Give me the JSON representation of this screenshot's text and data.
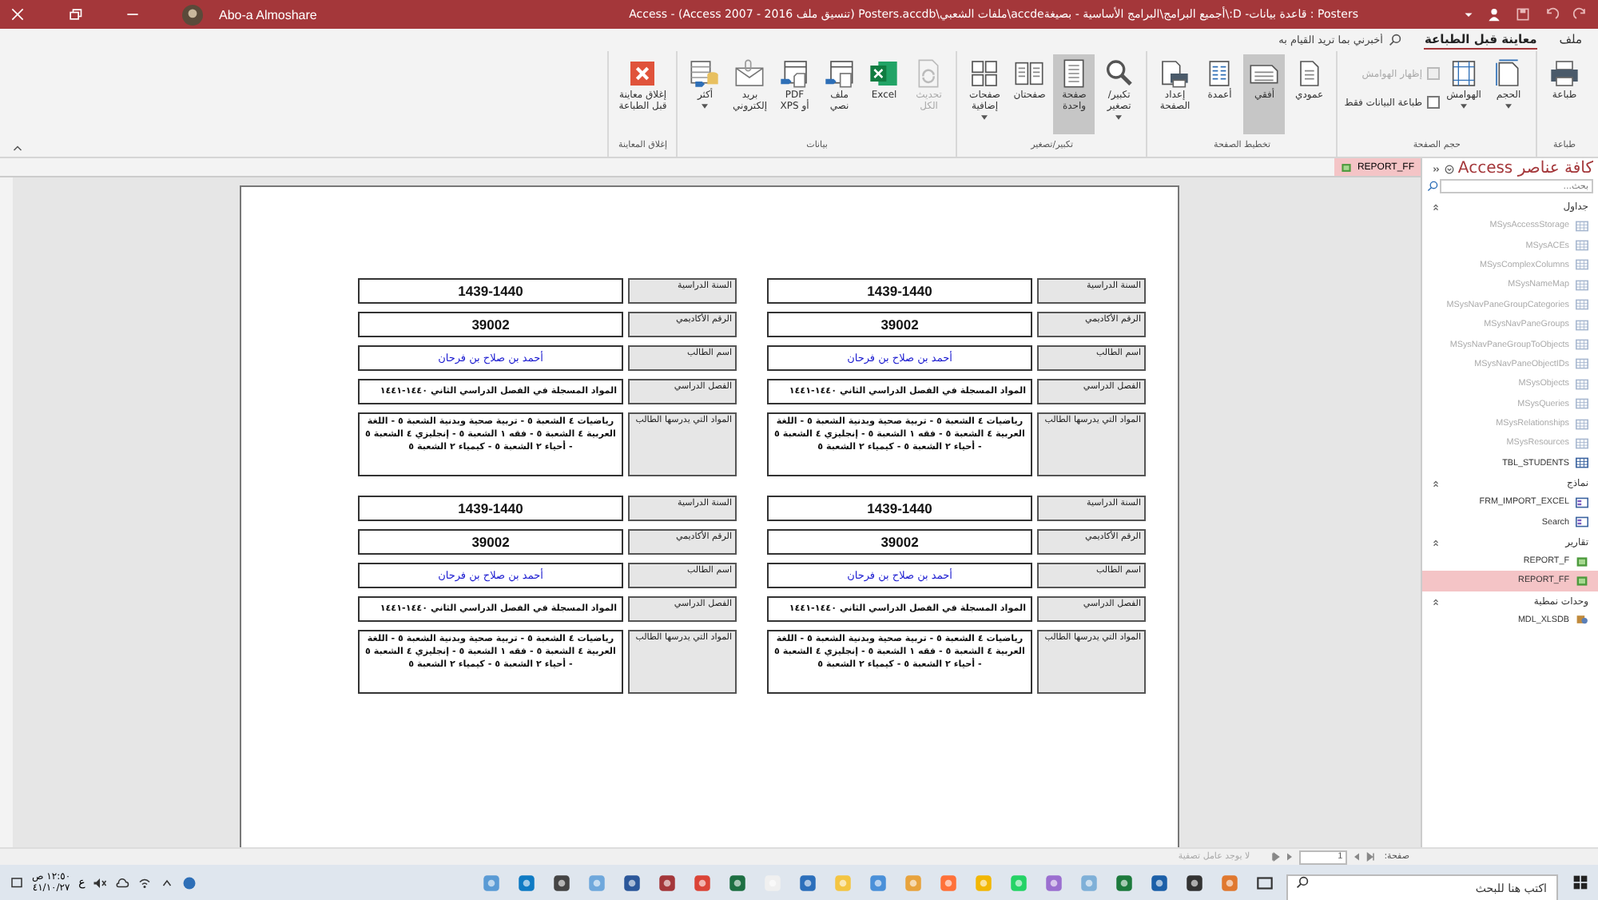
{
  "title_bar": {
    "title": "Posters : قاعدة بيانات- D:\\أجميع البرامج\\البرامج الأساسية - بصيغةaccde\\ملفات الشعبي\\Posters.accdb (تنسيق ملف 2016 - Access 2007) - Access",
    "user": "Abo-a Almoshare"
  },
  "ribbon": {
    "tabs": [
      {
        "label": "ملف",
        "selected": false
      },
      {
        "label": "معاينة قبل الطباعة",
        "selected": true
      }
    ],
    "tell_me": {
      "placeholder": "أخبرني بما تريد القيام به"
    },
    "groups": [
      {
        "label": "طباعة",
        "items": [
          {
            "kind": "large",
            "label": "طباعة",
            "selected": false,
            "disabled": false,
            "dropdown": false
          }
        ]
      },
      {
        "label": "حجم الصفحة",
        "items": [
          {
            "kind": "large",
            "label": "الحجم",
            "selected": false,
            "disabled": false,
            "dropdown": true
          },
          {
            "kind": "large",
            "label": "الهوامش",
            "selected": false,
            "disabled": false,
            "dropdown": true
          },
          {
            "kind": "checkbox",
            "label": "إظهار الهوامش",
            "checked": false,
            "disabled": true
          },
          {
            "kind": "checkbox",
            "label": "طباعة البيانات فقط",
            "checked": false,
            "disabled": false
          }
        ]
      },
      {
        "label": "تخطيط الصفحة",
        "items": [
          {
            "kind": "large",
            "label": "عمودي",
            "selected": false,
            "disabled": false,
            "dropdown": false
          },
          {
            "kind": "large",
            "label": "أفقي",
            "selected": true,
            "disabled": false,
            "dropdown": false
          },
          {
            "kind": "large",
            "label": "أعمدة",
            "selected": false,
            "disabled": false,
            "dropdown": false
          },
          {
            "kind": "large",
            "label": "إعداد\nالصفحة",
            "selected": false,
            "disabled": false,
            "dropdown": false
          }
        ]
      },
      {
        "label": "تكبير/تصغير",
        "items": [
          {
            "kind": "large",
            "label": "تكبير/\nتصغير",
            "selected": false,
            "disabled": false,
            "dropdown": true
          },
          {
            "kind": "large",
            "label": "صفحة\nواحدة",
            "selected": true,
            "disabled": false,
            "dropdown": false
          },
          {
            "kind": "large",
            "label": "صفحتان",
            "selected": false,
            "disabled": false,
            "dropdown": false
          },
          {
            "kind": "large",
            "label": "صفحات\nإضافية",
            "selected": false,
            "disabled": false,
            "dropdown": true
          }
        ]
      },
      {
        "label": "بيانات",
        "items": [
          {
            "kind": "large",
            "label": "تحديث\nالكل",
            "selected": false,
            "disabled": true,
            "dropdown": false
          },
          {
            "kind": "large",
            "label": "Excel",
            "selected": false,
            "disabled": false,
            "dropdown": false
          },
          {
            "kind": "large",
            "label": "ملف\nنصي",
            "selected": false,
            "disabled": false,
            "dropdown": false
          },
          {
            "kind": "large",
            "label": "PDF\nأو XPS",
            "selected": false,
            "disabled": false,
            "dropdown": false
          },
          {
            "kind": "large",
            "label": "بريد\nإلكتروني",
            "selected": false,
            "disabled": false,
            "dropdown": false
          },
          {
            "kind": "large",
            "label": "أكثر",
            "selected": false,
            "disabled": false,
            "dropdown": true
          }
        ]
      },
      {
        "label": "إغلاق المعاينة",
        "items": [
          {
            "kind": "large",
            "label": "إغلاق معاينة\nقبل الطباعة",
            "selected": false,
            "disabled": false,
            "dropdown": false
          }
        ]
      }
    ]
  },
  "document_tab": {
    "label": "REPORT_FF"
  },
  "report": {
    "cards": [
      {
        "fields": [
          {
            "kind": "heading",
            "label": "السنة الدراسية",
            "value": "1439-1440"
          },
          {
            "kind": "heading",
            "label": "الرقم الأكاديمي",
            "value": "39002"
          },
          {
            "kind": "name",
            "label": "اسم الطالب",
            "value": "أحمد بن صلاح بن فرحان"
          },
          {
            "kind": "line",
            "label": "الفصل الدراسي",
            "value": "المواد المسجلة في الفصل الدراسي الثاني ١٤٤٠-١٤٤١"
          },
          {
            "kind": "paragraph",
            "label": "المواد التي يدرسها الطالب",
            "value": "رياضيات ٤ الشعبة ٥ - تربية صحية وبدنية الشعبة ٥ - اللغة العربية ٤ الشعبة ٥ - فقه ١ الشعبة ٥ - إنجليزي ٤ الشعبة ٥ - أحياء ٢ الشعبة ٥ - كيمياء ٢ الشعبة ٥"
          }
        ]
      },
      {
        "fields": [
          {
            "kind": "heading",
            "label": "السنة الدراسية",
            "value": "1439-1440"
          },
          {
            "kind": "heading",
            "label": "الرقم الأكاديمي",
            "value": "39002"
          },
          {
            "kind": "name",
            "label": "اسم الطالب",
            "value": "أحمد بن صلاح بن فرحان"
          },
          {
            "kind": "line",
            "label": "الفصل الدراسي",
            "value": "المواد المسجلة في الفصل الدراسي الثاني ١٤٤٠-١٤٤١"
          },
          {
            "kind": "paragraph",
            "label": "المواد التي يدرسها الطالب",
            "value": "رياضيات ٤ الشعبة ٥ - تربية صحية وبدنية الشعبة ٥ - اللغة العربية ٤ الشعبة ٥ - فقه ١ الشعبة ٥ - إنجليزي ٤ الشعبة ٥ - أحياء ٢ الشعبة ٥ - كيمياء ٢ الشعبة ٥"
          }
        ]
      },
      {
        "fields": [
          {
            "kind": "heading",
            "label": "السنة الدراسية",
            "value": "1439-1440"
          },
          {
            "kind": "heading",
            "label": "الرقم الأكاديمي",
            "value": "39002"
          },
          {
            "kind": "name",
            "label": "اسم الطالب",
            "value": "أحمد بن صلاح بن فرحان"
          },
          {
            "kind": "line",
            "label": "الفصل الدراسي",
            "value": "المواد المسجلة في الفصل الدراسي الثاني ١٤٤٠-١٤٤١"
          },
          {
            "kind": "paragraph",
            "label": "المواد التي يدرسها الطالب",
            "value": "رياضيات ٤ الشعبة ٥ - تربية صحية وبدنية الشعبة ٥ - اللغة العربية ٤ الشعبة ٥ - فقه ١ الشعبة ٥ - إنجليزي ٤ الشعبة ٥ - أحياء ٢ الشعبة ٥ - كيمياء ٢ الشعبة ٥"
          }
        ]
      },
      {
        "fields": [
          {
            "kind": "heading",
            "label": "السنة الدراسية",
            "value": "1439-1440"
          },
          {
            "kind": "heading",
            "label": "الرقم الأكاديمي",
            "value": "39002"
          },
          {
            "kind": "name",
            "label": "اسم الطالب",
            "value": "أحمد بن صلاح بن فرحان"
          },
          {
            "kind": "line",
            "label": "الفصل الدراسي",
            "value": "المواد المسجلة في الفصل الدراسي الثاني ١٤٤٠-١٤٤١"
          },
          {
            "kind": "paragraph",
            "label": "المواد التي يدرسها الطالب",
            "value": "رياضيات ٤ الشعبة ٥ - تربية صحية وبدنية الشعبة ٥ - اللغة العربية ٤ الشعبة ٥ - فقه ١ الشعبة ٥ - إنجليزي ٤ الشعبة ٥ - أحياء ٢ الشعبة ٥ - كيمياء ٢ الشعبة ٥"
          }
        ]
      }
    ]
  },
  "navigation_pane": {
    "title": "كافة عناصر Access",
    "search": {
      "placeholder": "بحث..."
    },
    "groups": [
      {
        "kind": "tables",
        "label": "جداول",
        "items": [
          {
            "label": "MSysAccessStorage",
            "dimmed": true,
            "selected": false
          },
          {
            "label": "MSysACEs",
            "dimmed": true,
            "selected": false
          },
          {
            "label": "MSysComplexColumns",
            "dimmed": true,
            "selected": false
          },
          {
            "label": "MSysNameMap",
            "dimmed": true,
            "selected": false
          },
          {
            "label": "MSysNavPaneGroupCategories",
            "dimmed": true,
            "selected": false
          },
          {
            "label": "MSysNavPaneGroups",
            "dimmed": true,
            "selected": false
          },
          {
            "label": "MSysNavPaneGroupToObjects",
            "dimmed": true,
            "selected": false
          },
          {
            "label": "MSysNavPaneObjectIDs",
            "dimmed": true,
            "selected": false
          },
          {
            "label": "MSysObjects",
            "dimmed": true,
            "selected": false
          },
          {
            "label": "MSysQueries",
            "dimmed": true,
            "selected": false
          },
          {
            "label": "MSysRelationships",
            "dimmed": true,
            "selected": false
          },
          {
            "label": "MSysResources",
            "dimmed": true,
            "selected": false
          },
          {
            "label": "TBL_STUDENTS",
            "dimmed": false,
            "selected": false
          }
        ]
      },
      {
        "kind": "forms",
        "label": "نماذج",
        "items": [
          {
            "label": "FRM_IMPORT_EXCEL",
            "dimmed": false,
            "selected": false
          },
          {
            "label": "Search",
            "dimmed": false,
            "selected": false
          }
        ]
      },
      {
        "kind": "reports",
        "label": "تقارير",
        "items": [
          {
            "label": "REPORT_F",
            "dimmed": false,
            "selected": false
          },
          {
            "label": "REPORT_FF",
            "dimmed": false,
            "selected": true
          }
        ]
      },
      {
        "kind": "modules",
        "label": "وحدات نمطية",
        "items": [
          {
            "label": "MDL_XLSDB",
            "dimmed": false,
            "selected": false
          }
        ]
      }
    ]
  },
  "status_bar": {
    "page_label": "صفحة:",
    "page_value": "1",
    "filter": "لا يوجد عامل تصفية"
  },
  "taskbar": {
    "search": {
      "placeholder": "اكتب هنا للبحث"
    },
    "language": "ع",
    "time": "١٢:٥٠ ص",
    "date": "٤١/١٠/٢٧"
  }
}
